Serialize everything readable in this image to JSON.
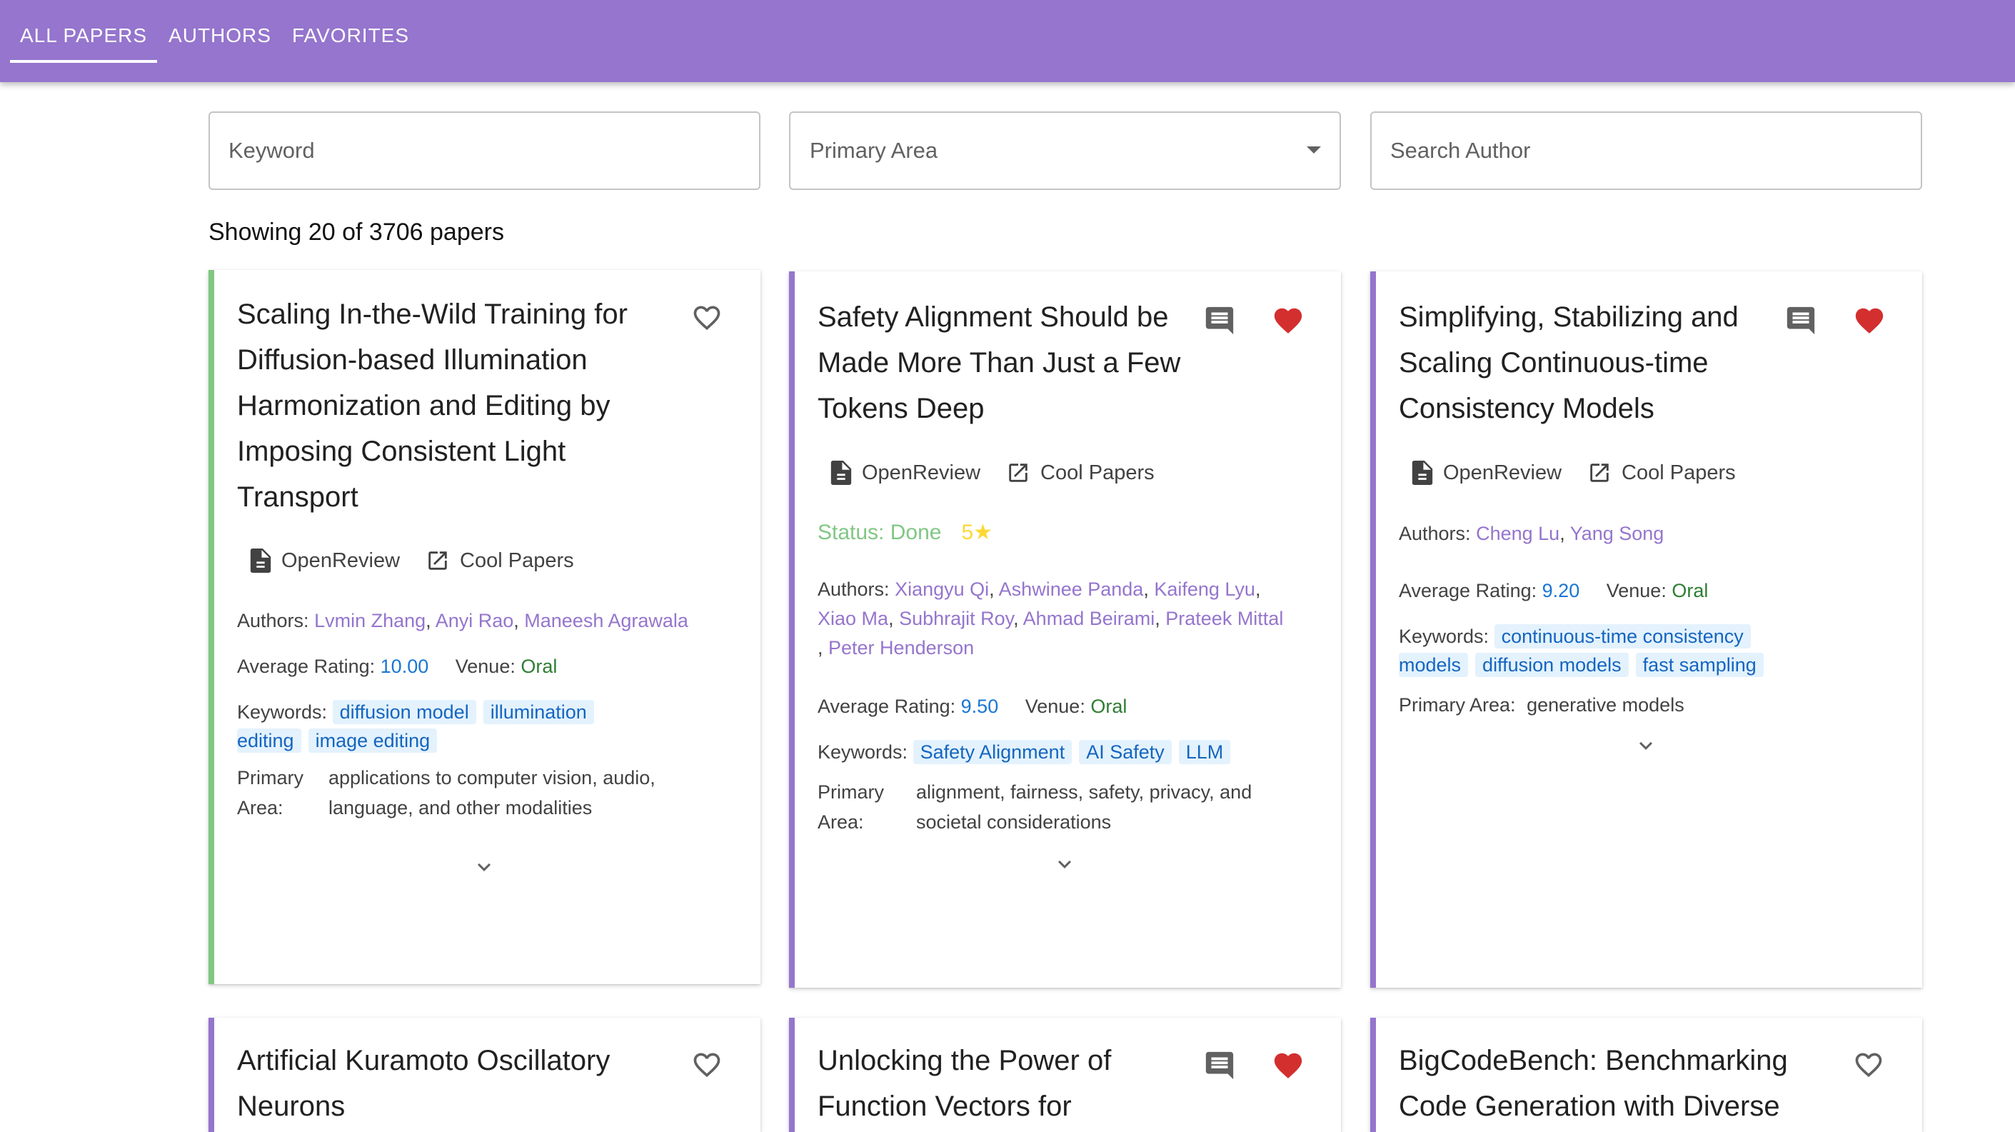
{
  "nav": {
    "tabs": [
      {
        "label": "ALL PAPERS",
        "active": true
      },
      {
        "label": "AUTHORS",
        "active": false
      },
      {
        "label": "FAVORITES",
        "active": false
      }
    ]
  },
  "filters": {
    "keyword_placeholder": "Keyword",
    "primary_area_label": "Primary Area",
    "author_placeholder": "Search Author"
  },
  "results": {
    "count_text": "Showing 20 of 3706 papers"
  },
  "labels": {
    "openreview": "OpenReview",
    "coolpapers": "Cool Papers",
    "authors": "Authors:",
    "average_rating": "Average Rating:",
    "venue": "Venue:",
    "keywords": "Keywords:",
    "primary_area": "Primary Area:",
    "primary": "Primary",
    "area": "Area:"
  },
  "colors": {
    "appbar": "#9575cd",
    "accent_green": "#81c784",
    "accent_purple": "#9575cd",
    "favorite_red": "#d32f2f",
    "rating_blue": "#1976d2",
    "venue_green": "#2e7d32",
    "chip_bg": "#e3f2fd"
  },
  "papers": [
    {
      "title_lines": [
        "Scaling In-the-Wild Training for",
        "Diffusion-based Illumination",
        "Harmonization and Editing by",
        "Imposing Consistent Light",
        "Transport"
      ],
      "favorited": false,
      "has_comment": false,
      "accent": "green",
      "authors": [
        "Lvmin Zhang",
        "Anyi Rao",
        "Maneesh Agrawala"
      ],
      "rating": "10.00",
      "venue": "Oral",
      "keywords_line1": [
        "diffusion model",
        "illumination"
      ],
      "keywords_line2": [
        "editing",
        "image editing"
      ],
      "primary_area_lines": [
        "applications to computer vision, audio,",
        "language, and other modalities"
      ]
    },
    {
      "title_lines": [
        "Safety Alignment Should be",
        "Made More Than Just a Few",
        "Tokens Deep"
      ],
      "favorited": true,
      "has_comment": true,
      "accent": "purple",
      "status": "Status: Done",
      "stars": "5★",
      "authors_line1": [
        "Xiangyu Qi",
        "Ashwinee Panda",
        "Kaifeng Lyu"
      ],
      "authors_line2": [
        "Xiao Ma",
        "Subhrajit Roy",
        "Ahmad Beirami",
        "Prateek Mittal"
      ],
      "authors_line3": [
        "Peter Henderson"
      ],
      "rating": "9.50",
      "venue": "Oral",
      "keywords": [
        "Safety Alignment",
        "AI Safety",
        "LLM"
      ],
      "primary_area_lines": [
        "alignment, fairness, safety, privacy, and",
        "societal considerations"
      ]
    },
    {
      "title_lines": [
        "Simplifying, Stabilizing and",
        "Scaling Continuous-time",
        "Consistency Models"
      ],
      "favorited": true,
      "has_comment": true,
      "accent": "purple",
      "authors": [
        "Cheng Lu",
        "Yang Song"
      ],
      "rating": "9.20",
      "venue": "Oral",
      "keywords_line1": [
        "continuous-time consistency"
      ],
      "keywords_line2": [
        "models",
        "diffusion models",
        "fast sampling"
      ],
      "primary_area": "generative models"
    },
    {
      "title_lines": [
        "Artificial Kuramoto Oscillatory",
        "Neurons"
      ],
      "favorited": false,
      "has_comment": false,
      "accent": "purple"
    },
    {
      "title_lines": [
        "Unlocking the Power of",
        "Function Vectors for"
      ],
      "favorited": true,
      "has_comment": true,
      "accent": "purple"
    },
    {
      "title_lines": [
        "BigCodeBench: Benchmarking",
        "Code Generation with Diverse"
      ],
      "favorited": false,
      "has_comment": false,
      "accent": "purple"
    }
  ]
}
